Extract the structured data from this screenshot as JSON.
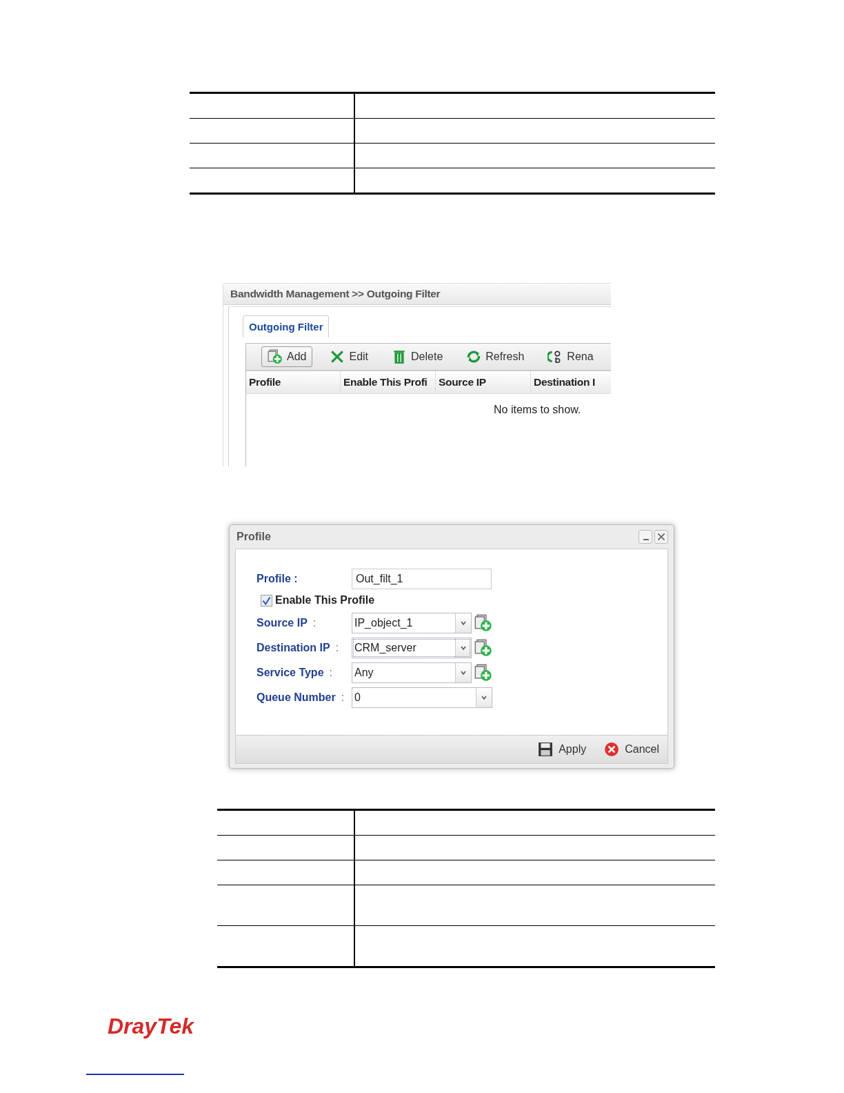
{
  "doc_tables": [
    {
      "rows": [
        {
          "kind": "single"
        },
        {
          "kind": "single"
        },
        {
          "kind": "single"
        },
        {
          "kind": "single"
        }
      ]
    },
    {
      "rows": [
        {
          "kind": "single"
        },
        {
          "kind": "single"
        },
        {
          "kind": "single"
        },
        {
          "kind": "double"
        },
        {
          "kind": "double"
        }
      ]
    }
  ],
  "filter_screen": {
    "breadcrumb": "Bandwidth Management >> Outgoing Filter",
    "tabs": [
      {
        "label": "Outgoing Filter",
        "selected": true
      }
    ],
    "toolbar": [
      {
        "kind": "add",
        "label": "Add",
        "focused": true
      },
      {
        "kind": "edit",
        "label": "Edit",
        "focused": false
      },
      {
        "kind": "delete",
        "label": "Delete",
        "focused": false
      },
      {
        "kind": "refresh",
        "label": "Refresh",
        "focused": false
      },
      {
        "kind": "rename",
        "label": "Rena",
        "focused": false
      }
    ],
    "columns": [
      "Profile",
      "Enable This Profi",
      "Source IP",
      "Destination I"
    ],
    "empty_message": "No items to show."
  },
  "dialog": {
    "title": "Profile",
    "fields": [
      {
        "kind": "text",
        "label": "Profile :",
        "value": "Out_filt_1"
      },
      {
        "kind": "checkbox",
        "label": "Enable This Profile",
        "checked": true
      },
      {
        "kind": "select",
        "label": "Source IP",
        "colon": ":",
        "value": "IP_object_1",
        "add_button": true,
        "focused": false
      },
      {
        "kind": "select",
        "label": "Destination IP",
        "colon": ":",
        "value": "CRM_server",
        "add_button": true,
        "focused": true
      },
      {
        "kind": "select",
        "label": "Service Type",
        "colon": ":",
        "value": "Any",
        "add_button": true,
        "focused": false
      },
      {
        "kind": "select",
        "label": "Queue Number",
        "colon": ":",
        "value": "0",
        "add_button": false,
        "focused": false
      }
    ],
    "buttons": [
      {
        "kind": "apply",
        "label": "Apply"
      },
      {
        "kind": "cancel",
        "label": "Cancel"
      }
    ]
  },
  "logo": "DrayTek"
}
